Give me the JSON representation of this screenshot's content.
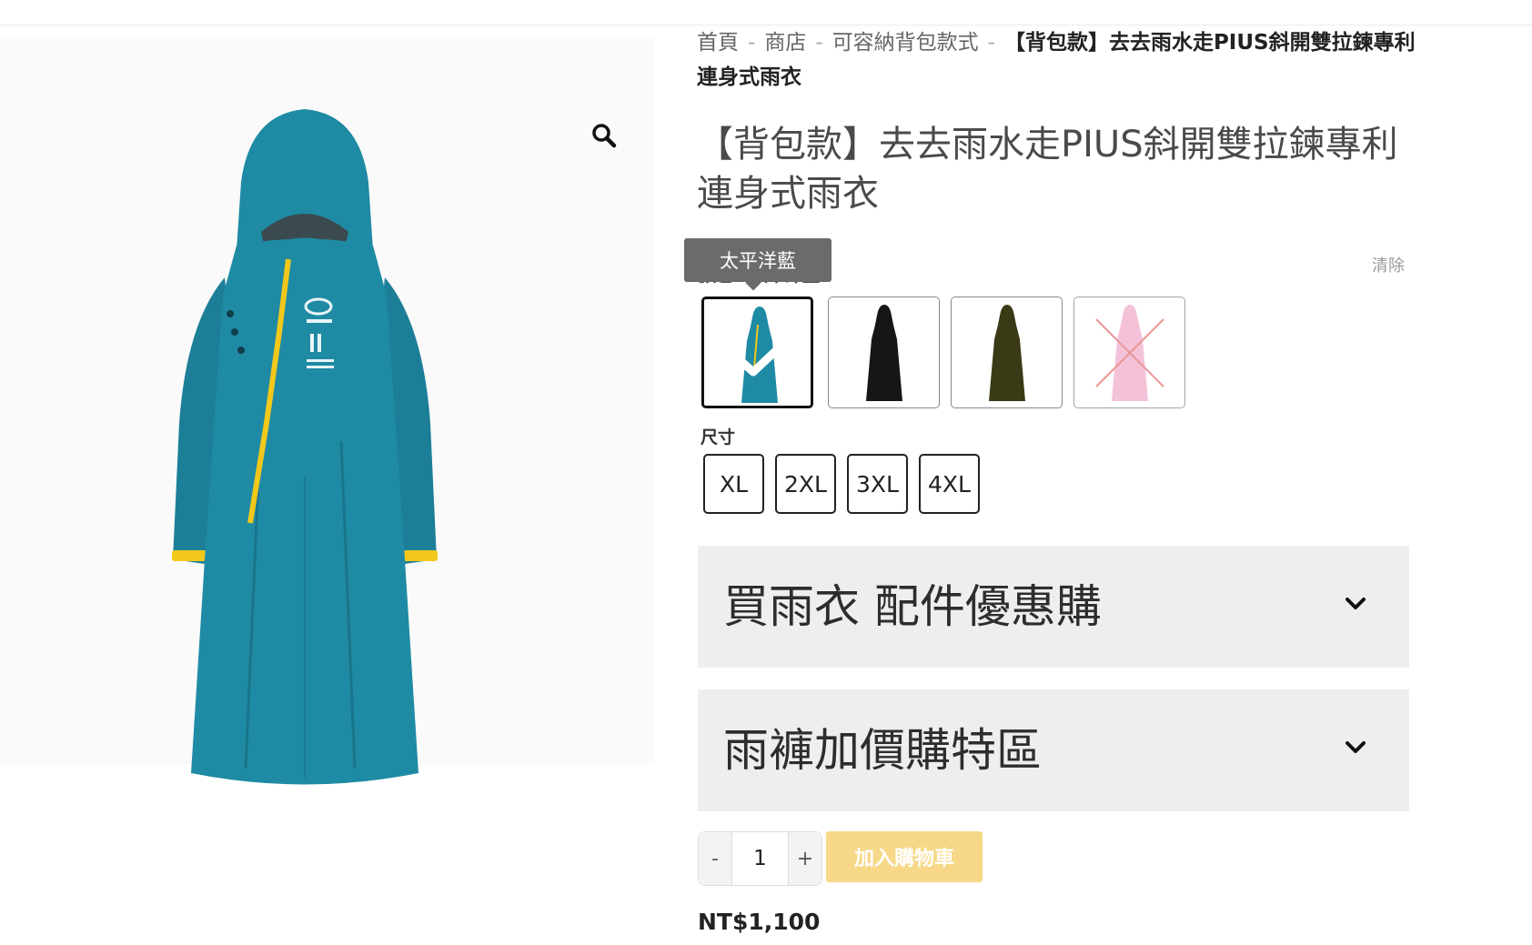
{
  "breadcrumb": {
    "home": "首頁",
    "shop": "商店",
    "category": "可容納背包款式",
    "current": "【背包款】去去雨水走PIUS斜開雙拉鍊專利連身式雨衣",
    "separator": "-"
  },
  "product": {
    "title": "【背包款】去去雨水走PIUS斜開雙拉鍊專利連身式雨衣",
    "price": "NT$1,100"
  },
  "gallery": {
    "zoom_icon": "magnifier-icon",
    "main_color": "#1f8aa3",
    "zip_color": "#f2c81c"
  },
  "variations": {
    "color_label": "顏色：太平洋藍",
    "clear_label": "清除",
    "tooltip": "太平洋藍",
    "swatches": [
      {
        "color": "#1f8aa3",
        "selected": true,
        "available": true
      },
      {
        "color": "#161616",
        "selected": false,
        "available": true
      },
      {
        "color": "#3b3a16",
        "selected": false,
        "available": true
      },
      {
        "color": "#f0aecb",
        "selected": false,
        "available": false
      }
    ],
    "size_label": "尺寸",
    "sizes": [
      "XL",
      "2XL",
      "3XL",
      "4XL"
    ]
  },
  "accordions": [
    {
      "title": "買雨衣 配件優惠購",
      "icon": "chevron-down-icon"
    },
    {
      "title": "雨褲加價購特區",
      "icon": "chevron-down-icon"
    }
  ],
  "cart": {
    "minus": "-",
    "plus": "+",
    "quantity": "1",
    "add_button": "加入購物車"
  }
}
